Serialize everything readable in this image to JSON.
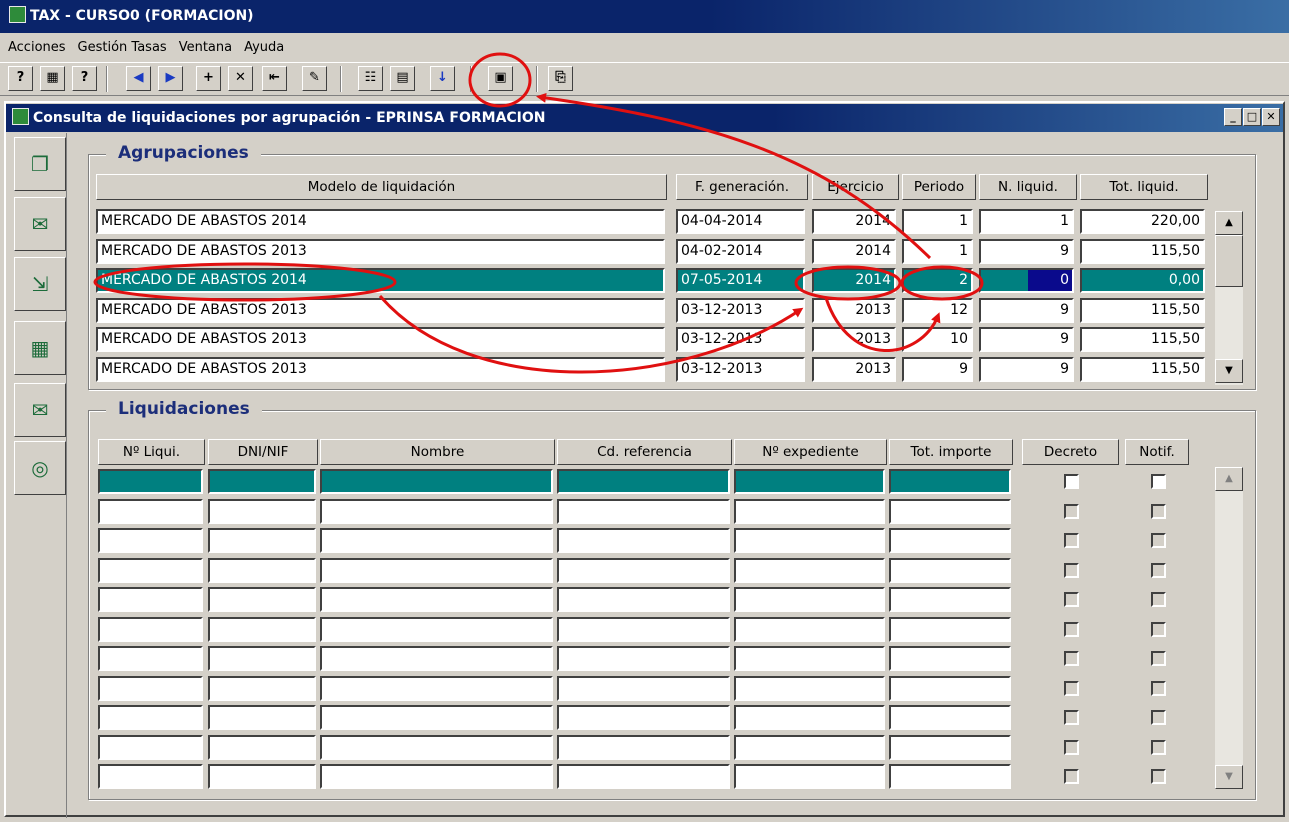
{
  "app": {
    "title": "TAX - CURSO0 (FORMACION)"
  },
  "menu": [
    "Acciones",
    "Gestión Tasas",
    "Ventana",
    "Ayuda"
  ],
  "toolbar": [
    {
      "icon": "query-icon",
      "glyph": "?"
    },
    {
      "icon": "query-all-icon",
      "glyph": "▦"
    },
    {
      "icon": "count-icon",
      "glyph": "?"
    },
    {
      "icon": "previous-icon",
      "glyph": "◀"
    },
    {
      "icon": "next-icon",
      "glyph": "▶"
    },
    {
      "icon": "insert-record-icon",
      "glyph": "+"
    },
    {
      "icon": "delete-record-icon",
      "glyph": "✕"
    },
    {
      "icon": "duplicate-icon",
      "glyph": "⇤"
    },
    {
      "icon": "edit-icon",
      "glyph": "✎"
    },
    {
      "icon": "list-icon",
      "glyph": "☷"
    },
    {
      "icon": "document-icon",
      "glyph": "▤"
    },
    {
      "icon": "download-icon",
      "glyph": "↓"
    },
    {
      "icon": "save-icon",
      "glyph": "▣"
    },
    {
      "icon": "exit-door-icon",
      "glyph": "⎘"
    }
  ],
  "window": {
    "title": "Consulta de liquidaciones por agrupación - EPRINSA FORMACION",
    "min": "_",
    "max": "□",
    "close": "✕"
  },
  "sidebar": [
    "copy-pages-icon",
    "print-mail-icon",
    "export-icon",
    "calculator-icon",
    "mail-icon",
    "report-glasses-icon"
  ],
  "agrupaciones": {
    "title": "Agrupaciones",
    "columns": [
      "Modelo de liquidación",
      "F. generación.",
      "Ejercicio",
      "Periodo",
      "N. liquid.",
      "Tot. liquid."
    ],
    "rows": [
      {
        "modelo": "MERCADO DE ABASTOS 2014",
        "fecha": "04-04-2014",
        "ejercicio": "2014",
        "periodo": "1",
        "nliq": "1",
        "total": "220,00"
      },
      {
        "modelo": "MERCADO DE ABASTOS 2013",
        "fecha": "04-02-2014",
        "ejercicio": "2014",
        "periodo": "1",
        "nliq": "9",
        "total": "115,50"
      },
      {
        "modelo": "MERCADO DE ABASTOS 2014",
        "fecha": "07-05-2014",
        "ejercicio": "2014",
        "periodo": "2",
        "nliq": "0",
        "total": "0,00"
      },
      {
        "modelo": "MERCADO DE ABASTOS 2013",
        "fecha": "03-12-2013",
        "ejercicio": "2013",
        "periodo": "12",
        "nliq": "9",
        "total": "115,50"
      },
      {
        "modelo": "MERCADO DE ABASTOS 2013",
        "fecha": "03-12-2013",
        "ejercicio": "2013",
        "periodo": "10",
        "nliq": "9",
        "total": "115,50"
      },
      {
        "modelo": "MERCADO DE ABASTOS 2013",
        "fecha": "03-12-2013",
        "ejercicio": "2013",
        "periodo": "9",
        "nliq": "9",
        "total": "115,50"
      }
    ],
    "selected_index": 2
  },
  "liquidaciones": {
    "title": "Liquidaciones",
    "columns": [
      "Nº Liqui.",
      "DNI/NIF",
      "Nombre",
      "Cd. referencia",
      "Nº expediente",
      "Tot. importe"
    ],
    "decreto_label": "Decreto",
    "notif_label": "Notif.",
    "row_count": 11
  },
  "colors": {
    "title_bar": "#0a246a",
    "selection": "#008080",
    "annotation": "#e01010",
    "group_title": "#1c2e7a"
  }
}
